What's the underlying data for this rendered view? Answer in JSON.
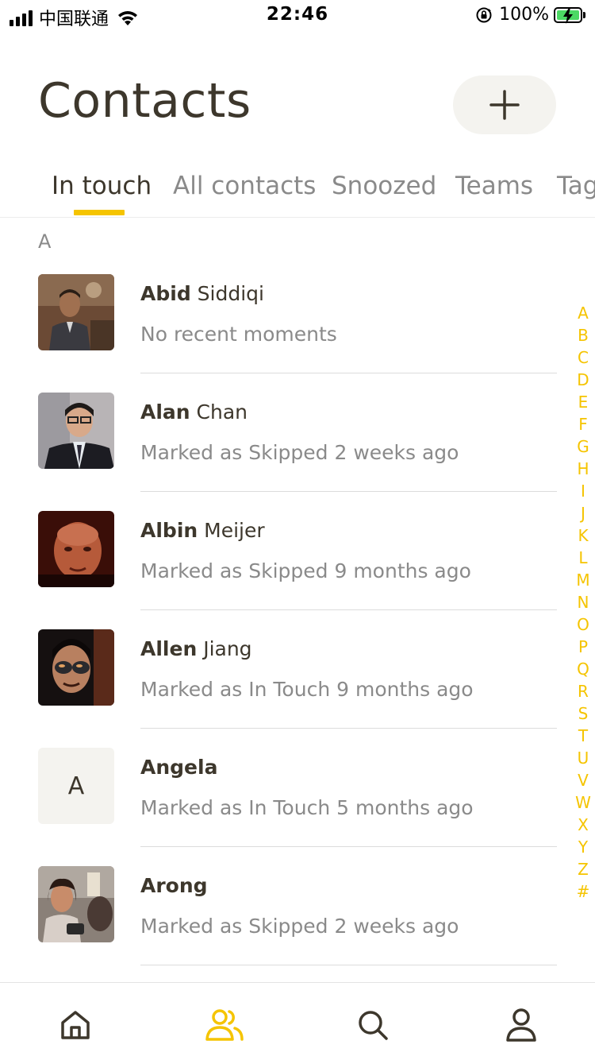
{
  "status_bar": {
    "carrier": "中国联通",
    "time": "22:46",
    "battery": "100%"
  },
  "header": {
    "title": "Contacts",
    "add_icon": "plus-icon"
  },
  "tabs": [
    {
      "label": "In touch",
      "active": true
    },
    {
      "label": "All contacts",
      "active": false
    },
    {
      "label": "Snoozed",
      "active": false
    },
    {
      "label": "Teams",
      "active": false
    },
    {
      "label": "Tag",
      "active": false
    }
  ],
  "section": {
    "letter": "A"
  },
  "contacts": [
    {
      "first": "Abid",
      "last": " Siddiqi",
      "status": "No recent moments",
      "avatar": "photo"
    },
    {
      "first": "Alan",
      "last": " Chan",
      "status": "Marked as Skipped 2 weeks ago",
      "avatar": "photo"
    },
    {
      "first": "Albin",
      "last": " Meijer",
      "status": "Marked as Skipped 9 months ago",
      "avatar": "photo"
    },
    {
      "first": "Allen",
      "last": " Jiang",
      "status": "Marked as In Touch 9 months ago",
      "avatar": "photo"
    },
    {
      "first": "Angela",
      "last": "",
      "status": "Marked as In Touch 5 months ago",
      "avatar": "initial",
      "initial": "A"
    },
    {
      "first": "Arong",
      "last": "",
      "status": "Marked as Skipped 2 weeks ago",
      "avatar": "photo"
    }
  ],
  "alphabet_index": [
    "A",
    "B",
    "C",
    "D",
    "E",
    "F",
    "G",
    "H",
    "I",
    "J",
    "K",
    "L",
    "M",
    "N",
    "O",
    "P",
    "Q",
    "R",
    "S",
    "T",
    "U",
    "V",
    "W",
    "X",
    "Y",
    "Z",
    "#"
  ],
  "bottom_nav": [
    {
      "icon": "home-icon",
      "active": false
    },
    {
      "icon": "contacts-icon",
      "active": true
    },
    {
      "icon": "search-icon",
      "active": false
    },
    {
      "icon": "profile-icon",
      "active": false
    }
  ],
  "colors": {
    "accent": "#f5c400",
    "text_primary": "#3d372c",
    "text_secondary": "#8a8a8a",
    "button_bg": "#f4f3ef",
    "battery_green": "#4cd964"
  }
}
